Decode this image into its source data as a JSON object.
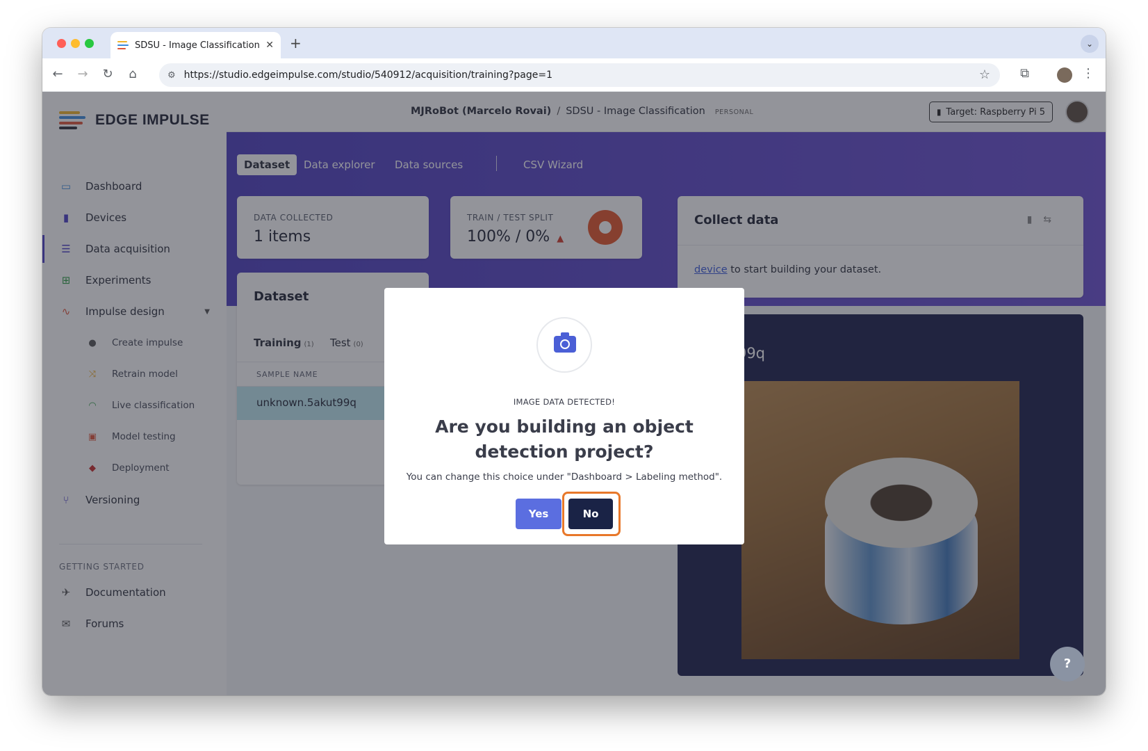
{
  "browser": {
    "tab_title": "SDSU - Image Classification",
    "tab_close": "✕",
    "new_tab": "+",
    "url": "https://studio.edgeimpulse.com/studio/540912/acquisition/training?page=1"
  },
  "sidebar": {
    "logo_text": "EDGE IMPULSE",
    "items": [
      {
        "label": "Dashboard",
        "icon": "monitor-icon"
      },
      {
        "label": "Devices",
        "icon": "chip-icon"
      },
      {
        "label": "Data acquisition",
        "icon": "database-icon"
      },
      {
        "label": "Experiments",
        "icon": "grid-icon"
      },
      {
        "label": "Impulse design",
        "icon": "pulse-icon"
      },
      {
        "label": "Create impulse",
        "icon": "dot-icon"
      },
      {
        "label": "Retrain model",
        "icon": "shuffle-icon"
      },
      {
        "label": "Live classification",
        "icon": "radar-icon"
      },
      {
        "label": "Model testing",
        "icon": "clipboard-icon"
      },
      {
        "label": "Deployment",
        "icon": "box-icon"
      },
      {
        "label": "Versioning",
        "icon": "branch-icon"
      }
    ],
    "section_title": "GETTING STARTED",
    "help_items": [
      {
        "label": "Documentation",
        "icon": "rocket-icon"
      },
      {
        "label": "Forums",
        "icon": "chat-icon"
      }
    ]
  },
  "header": {
    "owner": "MJRoBot (Marcelo Rovai)",
    "separator": "/",
    "project": "SDSU - Image Classification",
    "badge": "PERSONAL",
    "target": "Target: Raspberry Pi 5"
  },
  "subtabs": [
    "Dataset",
    "Data explorer",
    "Data sources",
    "CSV Wizard"
  ],
  "stats": {
    "collected_label": "DATA COLLECTED",
    "collected_value": "1 items",
    "split_label": "TRAIN / TEST SPLIT",
    "split_value": "100% / 0%"
  },
  "collect": {
    "title": "Collect data",
    "link_text": "device",
    "text": "to start building your dataset."
  },
  "dataset": {
    "title": "Dataset",
    "tab_training": "Training",
    "tab_training_count": "(1)",
    "tab_test": "Test",
    "tab_test_count": "(0)",
    "column_header": "SAMPLE NAME",
    "row_name": "unknown.5akut99q"
  },
  "preview": {
    "title": ".5akut99q"
  },
  "modal": {
    "kicker": "IMAGE DATA DETECTED!",
    "title": "Are you building an object detection project?",
    "note": "You can change this choice under \"Dashboard > Labeling method\".",
    "yes_label": "Yes",
    "no_label": "No"
  },
  "colors": {
    "accent": "#4d3fbf",
    "primary_button": "#5b6ee0",
    "dark_button": "#1a2346",
    "highlight_ring": "#e8782a",
    "selected_row": "#bfe9f1"
  }
}
